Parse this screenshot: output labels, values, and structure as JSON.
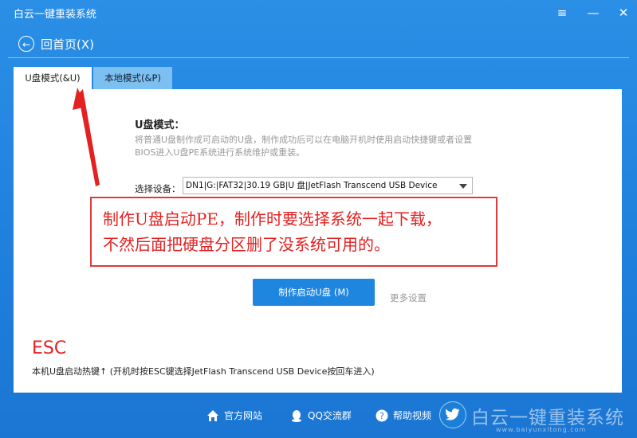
{
  "app": {
    "title": "白云一键重装系统"
  },
  "window": {
    "menu_icon": "≡",
    "min_icon": "—",
    "close_icon": "✕"
  },
  "nav": {
    "back_label": "回首页(X)"
  },
  "tabs": [
    {
      "label": "U盘模式(&U)",
      "active": true
    },
    {
      "label": "本地模式(&P)",
      "active": false
    }
  ],
  "usb_mode": {
    "title": "U盘模式：",
    "description": "将普通U盘制作成可启动的U盘，制作成功后可以在电脑开机时使用启动快捷键或者设置BIOS进入U盘PE系统进行系统维护或重装。",
    "device_label": "选择设备：",
    "device_value": "DN1|G:|FAT32|30.19 GB|U 盘|JetFlash Transcend USB Device",
    "make_button": "制作启动U盘 (M)",
    "more_settings": "更多设置",
    "esc_label": "ESC",
    "hotkey_text": "本机U盘启动热键↑ (开机时按ESC键选择JetFlash Transcend USB Device按回车进入)"
  },
  "annotation": {
    "line1": "制作U盘启动PE，制作时要选择系统一起下载，",
    "line2": "不然后面把硬盘分区删了没系统可用的。"
  },
  "footer": {
    "links": [
      {
        "label": "官方网站"
      },
      {
        "label": "QQ交流群"
      },
      {
        "label": "帮助视频"
      }
    ],
    "watermark": "白云一键重装系统",
    "watermark_url": "www.baiyunxitong.com"
  },
  "colors": {
    "accent": "#1f86df",
    "annotation": "#e42121",
    "background": "#2b8fe6"
  }
}
